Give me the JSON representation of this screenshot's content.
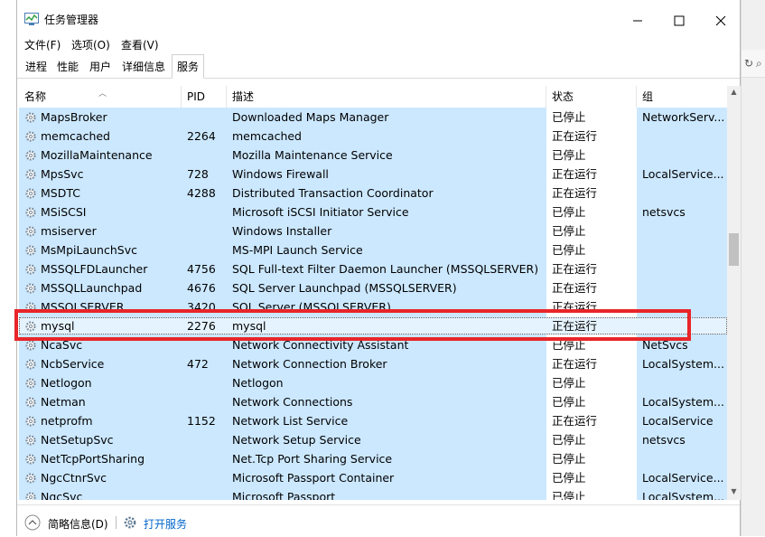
{
  "window": {
    "title": "任务管理器"
  },
  "menu": [
    "文件(F)",
    "选项(O)",
    "查看(V)"
  ],
  "tabs": [
    {
      "label": "进程",
      "active": false
    },
    {
      "label": "性能",
      "active": false
    },
    {
      "label": "用户",
      "active": false
    },
    {
      "label": "详细信息",
      "active": false
    },
    {
      "label": "服务",
      "active": true
    }
  ],
  "columns": [
    "名称",
    "PID",
    "描述",
    "状态",
    "组"
  ],
  "rows": [
    {
      "name": "MapsBroker",
      "pid": "",
      "desc": "Downloaded Maps Manager",
      "status": "已停止",
      "group": "NetworkServ..."
    },
    {
      "name": "memcached",
      "pid": "2264",
      "desc": "memcached",
      "status": "正在运行",
      "group": ""
    },
    {
      "name": "MozillaMaintenance",
      "pid": "",
      "desc": "Mozilla Maintenance Service",
      "status": "已停止",
      "group": ""
    },
    {
      "name": "MpsSvc",
      "pid": "728",
      "desc": "Windows Firewall",
      "status": "正在运行",
      "group": "LocalService..."
    },
    {
      "name": "MSDTC",
      "pid": "4288",
      "desc": "Distributed Transaction Coordinator",
      "status": "正在运行",
      "group": ""
    },
    {
      "name": "MSiSCSI",
      "pid": "",
      "desc": "Microsoft iSCSI Initiator Service",
      "status": "已停止",
      "group": "netsvcs"
    },
    {
      "name": "msiserver",
      "pid": "",
      "desc": "Windows Installer",
      "status": "已停止",
      "group": ""
    },
    {
      "name": "MsMpiLaunchSvc",
      "pid": "",
      "desc": "MS-MPI Launch Service",
      "status": "已停止",
      "group": ""
    },
    {
      "name": "MSSQLFDLauncher",
      "pid": "4756",
      "desc": "SQL Full-text Filter Daemon Launcher (MSSQLSERVER)",
      "status": "正在运行",
      "group": ""
    },
    {
      "name": "MSSQLLaunchpad",
      "pid": "4676",
      "desc": "SQL Server Launchpad (MSSQLSERVER)",
      "status": "正在运行",
      "group": ""
    },
    {
      "name": "MSSQLSERVER",
      "pid": "3420",
      "desc": "SQL Server (MSSQLSERVER)",
      "status": "正在运行",
      "group": ""
    },
    {
      "name": "mysql",
      "pid": "2276",
      "desc": "mysql",
      "status": "正在运行",
      "group": "",
      "selected": true
    },
    {
      "name": "NcaSvc",
      "pid": "",
      "desc": "Network Connectivity Assistant",
      "status": "已停止",
      "group": "NetSvcs"
    },
    {
      "name": "NcbService",
      "pid": "472",
      "desc": "Network Connection Broker",
      "status": "正在运行",
      "group": "LocalSystem..."
    },
    {
      "name": "Netlogon",
      "pid": "",
      "desc": "Netlogon",
      "status": "已停止",
      "group": ""
    },
    {
      "name": "Netman",
      "pid": "",
      "desc": "Network Connections",
      "status": "已停止",
      "group": "LocalSystem..."
    },
    {
      "name": "netprofm",
      "pid": "1152",
      "desc": "Network List Service",
      "status": "正在运行",
      "group": "LocalService"
    },
    {
      "name": "NetSetupSvc",
      "pid": "",
      "desc": "Network Setup Service",
      "status": "已停止",
      "group": "netsvcs"
    },
    {
      "name": "NetTcpPortSharing",
      "pid": "",
      "desc": "Net.Tcp Port Sharing Service",
      "status": "已停止",
      "group": ""
    },
    {
      "name": "NgcCtnrSvc",
      "pid": "",
      "desc": "Microsoft Passport Container",
      "status": "已停止",
      "group": "LocalService..."
    },
    {
      "name": "NgcSvc",
      "pid": "",
      "desc": "Microsoft Passport",
      "status": "已停止",
      "group": "LocalSystem..."
    }
  ],
  "footer": {
    "fewer_details": "简略信息(D)",
    "open_services": "打开服务"
  },
  "colors": {
    "accent": "#cce8ff",
    "highlight": "#e8252a",
    "link": "#0066cc"
  }
}
